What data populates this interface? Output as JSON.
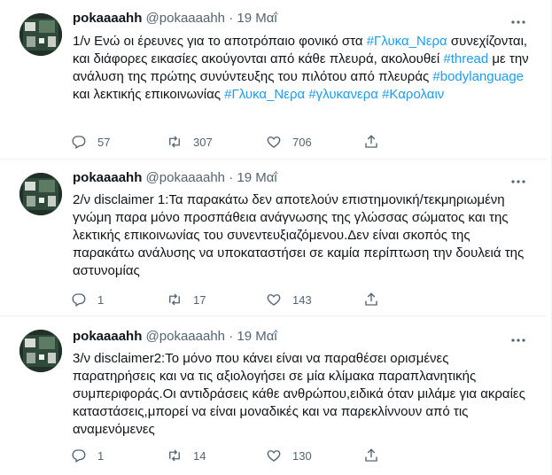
{
  "tweets": [
    {
      "name": "pokaaaahh",
      "handle": "@pokaaaahh",
      "dot": "·",
      "date": "19 Μαΐ",
      "text": [
        {
          "t": "1/ν Ενώ οι έρευνες για το αποτρόπαιο φονικό στα ",
          "h": false
        },
        {
          "t": "#Γλυκα_Νερα",
          "h": true
        },
        {
          "t": " συνεχίζονται, και διάφορες εικασίες ακούγονται από κάθε πλευρά, ακολουθεί ",
          "h": false
        },
        {
          "t": "#thread",
          "h": true
        },
        {
          "t": " με την ανάλυση της πρώτης συνύντευξης του πιλότου από πλευράς ",
          "h": false
        },
        {
          "t": "#bodylanguage",
          "h": true
        },
        {
          "t": " και λεκτικής επικοινωνίας ",
          "h": false
        },
        {
          "t": "#Γλυκα_Νερα",
          "h": true
        },
        {
          "t": " ",
          "h": false
        },
        {
          "t": "#γλυκανερα",
          "h": true
        },
        {
          "t": " ",
          "h": false
        },
        {
          "t": "#Καρολαιν",
          "h": true
        }
      ],
      "replies": "57",
      "retweets": "307",
      "likes": "706"
    },
    {
      "name": "pokaaaahh",
      "handle": "@pokaaaahh",
      "dot": "·",
      "date": "19 Μαΐ",
      "text": [
        {
          "t": "2/ν disclaimer 1:Τα παρακάτω δεν αποτελούν επιστημονική/τεκμηριωμένη γνώμη παρα μόνο προσπάθεια ανάγνωσης της γλώσσας σώματος και της λεκτικής επικοινωνίας του συνεντευξιαζόμενου.Δεν είναι σκοπός της παρακάτω ανάλυσης να υποκαταστήσει σε καμία περίπτωση την δουλειά της αστυνομίας",
          "h": false
        }
      ],
      "replies": "1",
      "retweets": "17",
      "likes": "143"
    },
    {
      "name": "pokaaaahh",
      "handle": "@pokaaaahh",
      "dot": "·",
      "date": "19 Μαΐ",
      "text": [
        {
          "t": "3/ν disclaimer2:Το μόνο που κάνει είναι να παραθέσει ορισμένες παρατηρήσεις και να τις αξιολογήσει σε μία κλίμακα παραπλανητικής συμπεριφοράς.Οι αντιδράσεις κάθε ανθρώπου,ειδικά όταν μιλάμε για ακραίες καταστάσεις,μπορεί να είναι μοναδικές και να παρεκλίννουν από τις αναμενόμενες",
          "h": false
        }
      ],
      "replies": "1",
      "retweets": "14",
      "likes": "130"
    }
  ],
  "icons": {
    "avatar": "avatar-image",
    "more": "more-options-icon",
    "reply": "reply-icon",
    "retweet": "retweet-icon",
    "like": "heart-icon",
    "share": "share-icon"
  },
  "colors": {
    "hashtag": "#1d9bf0",
    "secondary": "#536471",
    "text": "#0f1419",
    "divider": "#eff3f4"
  }
}
